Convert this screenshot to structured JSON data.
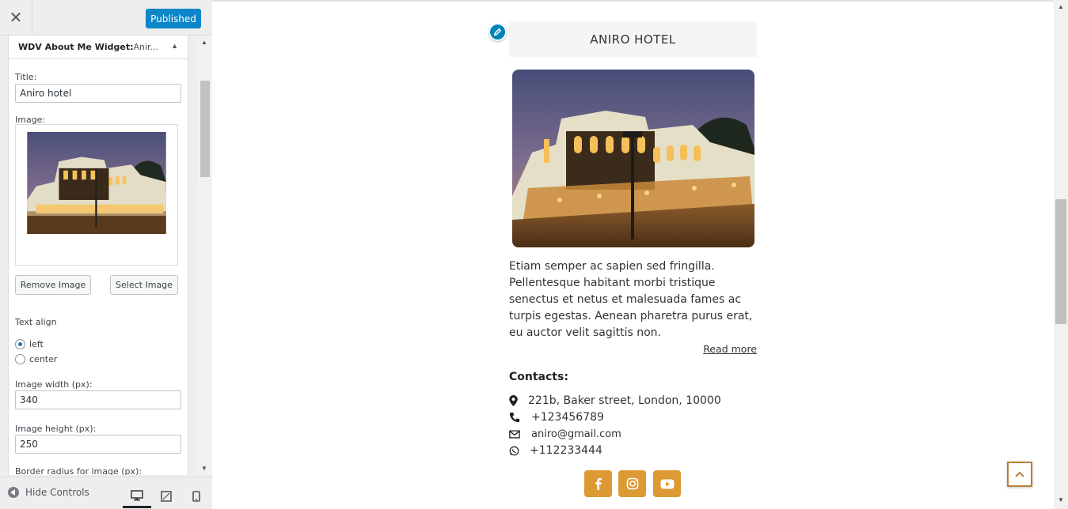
{
  "header": {
    "close_icon": "close-icon",
    "publish_label": "Published"
  },
  "widget": {
    "title_bold": "WDV About Me Widget:",
    "title_rest": "Aniro hotel",
    "title_display_rest": " Anir...",
    "fields": {
      "title_label": "Title:",
      "title_value": "Aniro hotel",
      "image_label": "Image:",
      "remove_image": "Remove Image",
      "select_image": "Select Image",
      "text_align_label": "Text align",
      "align_options": [
        "left",
        "center"
      ],
      "align_selected": "left",
      "image_width_label": "Image width (px):",
      "image_width_value": "340",
      "image_height_label": "Image height (px):",
      "image_height_value": "250",
      "border_radius_label": "Border radius for image (px):"
    }
  },
  "footer": {
    "hide_controls": "Hide Controls",
    "devices": [
      "desktop-icon",
      "tablet-icon",
      "mobile-icon"
    ],
    "active_device": "desktop"
  },
  "preview": {
    "title": "ANIRO HOTEL",
    "about": "Etiam semper ac sapien sed fringilla. Pellentesque habitant morbi tristique senectus et netus et malesuada fames ac turpis egestas. Aenean pharetra purus erat, eu auctor velit sagittis non.",
    "read_more": "Read more",
    "contacts_title": "Contacts:",
    "contacts": {
      "address": "221b, Baker street, London, 10000",
      "phone": "+123456789",
      "email": "aniro@gmail.com",
      "whatsapp": "+112233444"
    },
    "social": [
      "facebook-icon",
      "instagram-icon",
      "youtube-icon"
    ],
    "accent_color": "#dd9933"
  }
}
